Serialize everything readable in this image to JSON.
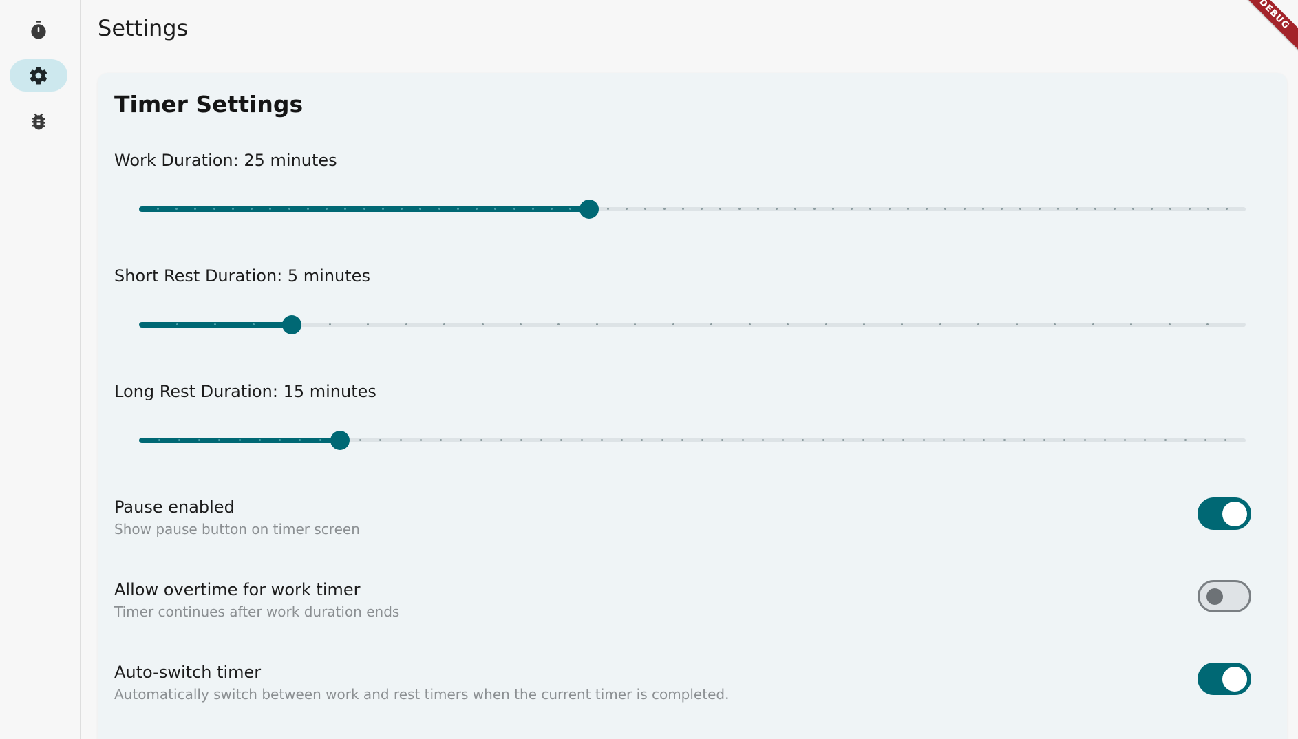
{
  "app": {
    "debug_banner": "DEBUG"
  },
  "rail": {
    "items": [
      {
        "icon": "timer-icon",
        "label": "",
        "active": false
      },
      {
        "icon": "gear-icon",
        "label": "",
        "active": true
      },
      {
        "icon": "bug-icon",
        "label": "",
        "active": false
      }
    ]
  },
  "header": {
    "title": "Settings"
  },
  "card": {
    "title": "Timer Settings",
    "sliders": [
      {
        "label": "Work Duration: 25 minutes",
        "value": 25,
        "min": 1,
        "max": 60
      },
      {
        "label": "Short Rest Duration: 5 minutes",
        "value": 5,
        "min": 1,
        "max": 30
      },
      {
        "label": "Long Rest Duration: 15 minutes",
        "value": 15,
        "min": 5,
        "max": 60
      }
    ],
    "toggles": [
      {
        "title": "Pause enabled",
        "subtitle": "Show pause button on timer screen",
        "on": true
      },
      {
        "title": "Allow overtime for work timer",
        "subtitle": "Timer continues after work duration ends",
        "on": false
      },
      {
        "title": "Auto-switch timer",
        "subtitle": "Automatically switch between work and rest timers when the current timer is completed.",
        "on": true
      }
    ]
  },
  "colors": {
    "accent": "#006874",
    "rail_active": "#cde8ee",
    "card_bg": "#eff4f6"
  }
}
